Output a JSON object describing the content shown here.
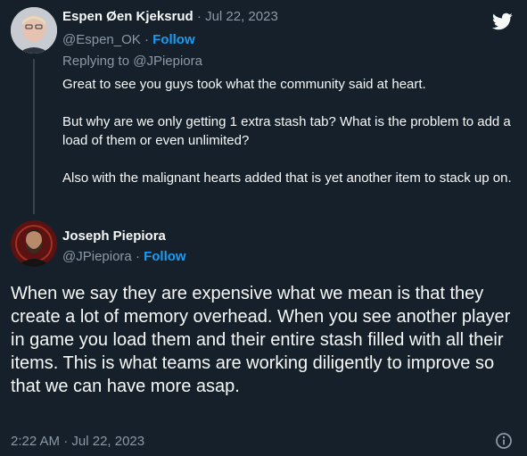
{
  "tweet1": {
    "display_name": "Espen Øen Kjeksrud",
    "date": "Jul 22, 2023",
    "separator": "·",
    "handle": "@Espen_OK",
    "follow_label": "Follow",
    "replying_to_prefix": "Replying to",
    "replying_to_handle": "@JPiepiora",
    "body": [
      "Great to see you guys took what the community said at heart.",
      "But why are we only getting 1 extra stash tab? What is the problem to add a load of them or even unlimited?",
      "Also with the malignant hearts added that is yet another item to stack up on."
    ]
  },
  "tweet2": {
    "display_name": "Joseph Piepiora",
    "handle": "@JPiepiora",
    "separator": "·",
    "follow_label": "Follow",
    "body": "When we say they are expensive what we mean is that they create a lot of memory overhead. When you see another player in game you load them and their entire stash filled with all their items. This is what teams are working diligently to improve so that we can have more asap.",
    "time": "2:22 AM",
    "date": "Jul 22, 2023"
  },
  "colors": {
    "background": "#15202b",
    "text": "#f7f9f9",
    "muted": "#8b98a5",
    "accent": "#1d9bf0",
    "thread_line": "#38444d"
  },
  "icons": {
    "brand": "twitter-bird-icon",
    "info": "info-icon"
  }
}
